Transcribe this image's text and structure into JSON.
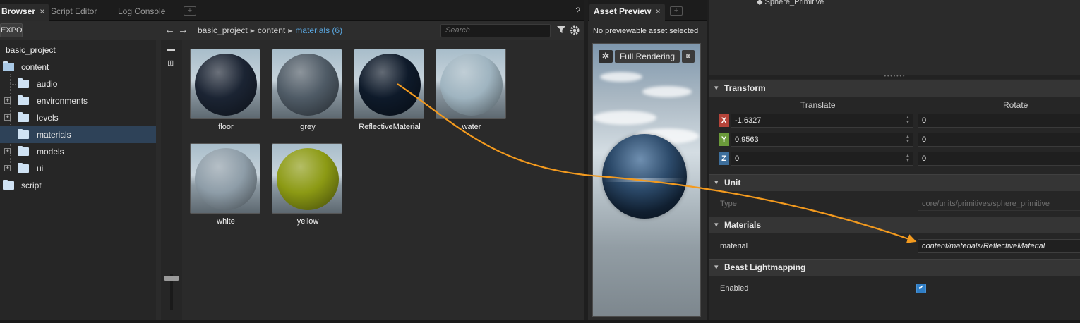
{
  "browser": {
    "tabs": [
      {
        "label": "Browser",
        "close": "×"
      },
      {
        "label": "Script Editor"
      },
      {
        "label": "Log Console"
      }
    ],
    "help": "?",
    "export_label": "EXPORT",
    "breadcrumbs": [
      "basic_project",
      "content"
    ],
    "current_folder": "materials (6)",
    "search_placeholder": "Search",
    "tree": [
      {
        "label": "basic_project"
      },
      {
        "label": "content"
      },
      {
        "label": "audio"
      },
      {
        "label": "environments"
      },
      {
        "label": "levels"
      },
      {
        "label": "materials"
      },
      {
        "label": "models"
      },
      {
        "label": "ui"
      },
      {
        "label": "script"
      }
    ],
    "assets": [
      {
        "label": "floor",
        "color": "#1b2433"
      },
      {
        "label": "grey",
        "color": "#4f5b66"
      },
      {
        "label": "ReflectiveMaterial",
        "color": "#0e1a2a"
      },
      {
        "label": "water",
        "color": "#9fb4c0"
      },
      {
        "label": "white",
        "color": "#8e9da8"
      },
      {
        "label": "yellow",
        "color": "#8c9a14"
      }
    ]
  },
  "preview": {
    "tab_label": "Asset Preview",
    "close": "×",
    "message": "No previewable asset selected",
    "render_mode": "Full Rendering"
  },
  "properties": {
    "scene_item": "Sphere_Primitive",
    "transform": {
      "title": "Transform",
      "translate_label": "Translate",
      "rotate_label": "Rotate",
      "rows": [
        {
          "axis": "X",
          "translate": "-1.6327",
          "rotate": "0",
          "color": "#b5443a"
        },
        {
          "axis": "Y",
          "translate": "0.9563",
          "rotate": "0",
          "color": "#6b9a3a"
        },
        {
          "axis": "Z",
          "translate": "0",
          "rotate": "0",
          "color": "#3e6f9c"
        }
      ]
    },
    "unit": {
      "title": "Unit",
      "type_label": "Type",
      "type_value": "core/units/primitives/sphere_primitive"
    },
    "materials": {
      "title": "Materials",
      "material_label": "material",
      "material_value": "content/materials/ReflectiveMaterial"
    },
    "beast": {
      "title": "Beast Lightmapping",
      "enabled_label": "Enabled",
      "enabled": true
    }
  },
  "colors": {
    "accent": "#5aa7e0",
    "arrow": "#f39a1e",
    "selection": "#2e4258"
  }
}
